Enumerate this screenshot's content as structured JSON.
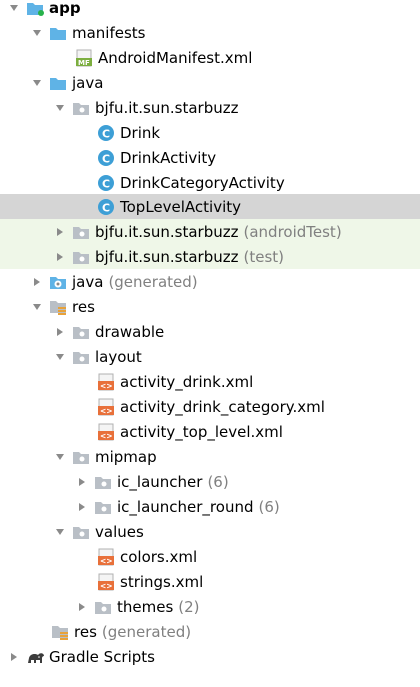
{
  "tree": {
    "rows": [
      {
        "label": "app",
        "suffix": "",
        "icon": "module-folder-icon",
        "expanded": true
      },
      {
        "label": "manifests",
        "suffix": "",
        "icon": "folder-icon",
        "expanded": true
      },
      {
        "label": "AndroidManifest.xml",
        "suffix": "",
        "icon": "manifest-file-icon",
        "icon_text": "MF"
      },
      {
        "label": "java",
        "suffix": "",
        "icon": "folder-icon",
        "expanded": true
      },
      {
        "label": "bjfu.it.sun.starbuzz",
        "suffix": "",
        "icon": "package-icon",
        "expanded": true
      },
      {
        "label": "Drink",
        "suffix": "",
        "icon": "class-icon",
        "icon_text": "C"
      },
      {
        "label": "DrinkActivity",
        "suffix": "",
        "icon": "class-icon",
        "icon_text": "C"
      },
      {
        "label": "DrinkCategoryActivity",
        "suffix": "",
        "icon": "class-icon",
        "icon_text": "C"
      },
      {
        "label": "TopLevelActivity",
        "suffix": "",
        "icon": "class-icon",
        "icon_text": "C",
        "selected": true
      },
      {
        "label": "bjfu.it.sun.starbuzz",
        "suffix": "(androidTest)",
        "icon": "package-icon",
        "expanded": false
      },
      {
        "label": "bjfu.it.sun.starbuzz",
        "suffix": "(test)",
        "icon": "package-icon",
        "expanded": false
      },
      {
        "label": "java",
        "suffix": "(generated)",
        "icon": "generated-folder-icon",
        "expanded": false
      },
      {
        "label": "res",
        "suffix": "",
        "icon": "res-folder-icon",
        "expanded": true
      },
      {
        "label": "drawable",
        "suffix": "",
        "icon": "package-icon",
        "expanded": false
      },
      {
        "label": "layout",
        "suffix": "",
        "icon": "package-icon",
        "expanded": true
      },
      {
        "label": "activity_drink.xml",
        "suffix": "",
        "icon": "xml-file-icon",
        "icon_text": "<>"
      },
      {
        "label": "activity_drink_category.xml",
        "suffix": "",
        "icon": "xml-file-icon",
        "icon_text": "<>"
      },
      {
        "label": "activity_top_level.xml",
        "suffix": "",
        "icon": "xml-file-icon",
        "icon_text": "<>"
      },
      {
        "label": "mipmap",
        "suffix": "",
        "icon": "package-icon",
        "expanded": true
      },
      {
        "label": "ic_launcher",
        "suffix": "(6)",
        "icon": "package-icon",
        "expanded": false
      },
      {
        "label": "ic_launcher_round",
        "suffix": "(6)",
        "icon": "package-icon",
        "expanded": false
      },
      {
        "label": "values",
        "suffix": "",
        "icon": "package-icon",
        "expanded": true
      },
      {
        "label": "colors.xml",
        "suffix": "",
        "icon": "xml-file-icon",
        "icon_text": "<>"
      },
      {
        "label": "strings.xml",
        "suffix": "",
        "icon": "xml-file-icon",
        "icon_text": "<>"
      },
      {
        "label": "themes",
        "suffix": "(2)",
        "icon": "package-icon",
        "expanded": false
      },
      {
        "label": "res",
        "suffix": "(generated)",
        "icon": "res-folder-icon"
      },
      {
        "label": "Gradle Scripts",
        "suffix": "",
        "icon": "gradle-icon",
        "expanded": false
      }
    ]
  },
  "colors": {
    "selected_row": "#d5d5d5",
    "test_row": "#eff7e8",
    "folder_blue": "#5fb3e6",
    "class_blue": "#3d9fd6",
    "xml_orange": "#e8703a",
    "suffix_gray": "#808080"
  }
}
